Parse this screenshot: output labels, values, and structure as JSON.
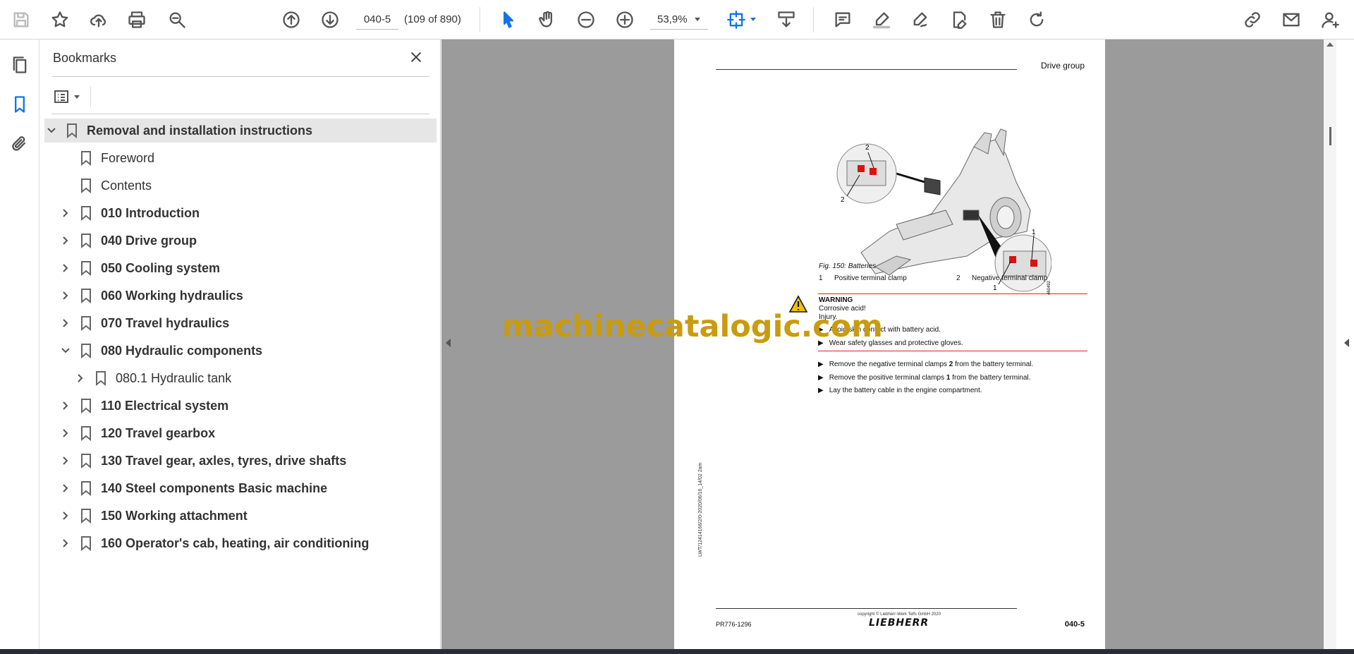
{
  "toolbar": {
    "page_input": "040-5",
    "page_count": "(109 of 890)",
    "zoom": "53,9%"
  },
  "bookmarks_panel": {
    "title": "Bookmarks",
    "items": [
      {
        "label": "Removal and installation instructions",
        "level": 0,
        "chevron": "down",
        "bold": true,
        "selected": true
      },
      {
        "label": "Foreword",
        "level": 1,
        "chevron": "none",
        "bold": false
      },
      {
        "label": "Contents",
        "level": 1,
        "chevron": "none",
        "bold": false
      },
      {
        "label": "010 Introduction",
        "level": 1,
        "chevron": "right",
        "bold": true
      },
      {
        "label": "040 Drive group",
        "level": 1,
        "chevron": "right",
        "bold": true
      },
      {
        "label": "050 Cooling system",
        "level": 1,
        "chevron": "right",
        "bold": true
      },
      {
        "label": "060 Working hydraulics",
        "level": 1,
        "chevron": "right",
        "bold": true
      },
      {
        "label": "070 Travel hydraulics",
        "level": 1,
        "chevron": "right",
        "bold": true
      },
      {
        "label": "080 Hydraulic components",
        "level": 1,
        "chevron": "down",
        "bold": true
      },
      {
        "label": "080.1 Hydraulic tank",
        "level": 2,
        "chevron": "right",
        "bold": false
      },
      {
        "label": "110 Electrical system",
        "level": 1,
        "chevron": "right",
        "bold": true
      },
      {
        "label": "120 Travel gearbox",
        "level": 1,
        "chevron": "right",
        "bold": true
      },
      {
        "label": "130 Travel gear, axles, tyres, drive shafts",
        "level": 1,
        "chevron": "right",
        "bold": true
      },
      {
        "label": "140 Steel components Basic machine",
        "level": 1,
        "chevron": "right",
        "bold": true
      },
      {
        "label": "150 Working attachment",
        "level": 1,
        "chevron": "right",
        "bold": true
      },
      {
        "label": "160 Operator's cab, heating, air conditioning",
        "level": 1,
        "chevron": "right",
        "bold": true
      }
    ]
  },
  "document": {
    "header_title": "Drive group",
    "figure_caption": "Fig. 150: Batteries",
    "figure_callouts": [
      "1",
      "2",
      "1",
      "2"
    ],
    "figure_id": "460492",
    "legend": [
      {
        "num": "1",
        "text": "Positive terminal clamp"
      },
      {
        "num": "2",
        "text": "Negative terminal clamp"
      }
    ],
    "warning": {
      "title": "WARNING",
      "hazard": "Corrosive acid!",
      "consequence": "Injury.",
      "actions": [
        "Avoid skin contact with battery acid.",
        "Wear safety glasses and protective gloves."
      ]
    },
    "steps": [
      {
        "pre": "Remove the negative terminal clamps ",
        "num": "2",
        "post": " from the battery terminal."
      },
      {
        "pre": "Remove the positive terminal clamps ",
        "num": "1",
        "post": " from the battery terminal."
      },
      {
        "pre": "Lay the battery cable in the engine compartment.",
        "num": "",
        "post": ""
      }
    ],
    "side_reference": "LWT/12414166/2/0-2020/06/16_14/02 2am",
    "footer_left": "PR776-1296",
    "footer_copyright": "copyright © Liebherr-Werk Telfs GmbH 2020",
    "footer_logo": "LIEBHERR",
    "footer_right": "040-5"
  },
  "watermark": "machinecatalogic.com",
  "colors": {
    "accent_blue": "#1473e6",
    "viewer_bg": "#9b9b9b",
    "warning_red": "#d22222",
    "watermark": "#c99b0e"
  }
}
